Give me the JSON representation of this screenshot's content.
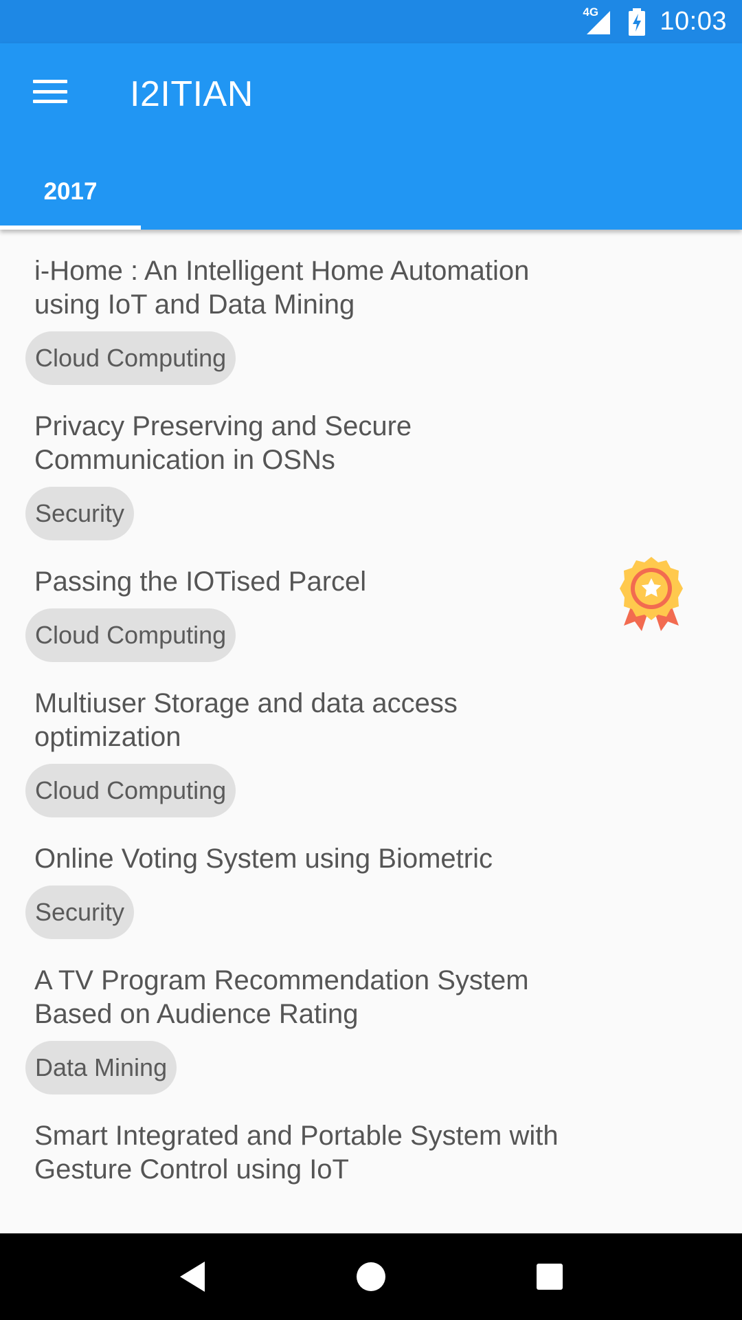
{
  "status_bar": {
    "network_label": "4G",
    "time": "10:03"
  },
  "app_bar": {
    "title": "I2ITIAN",
    "menu_icon": "hamburger-menu-icon"
  },
  "tabs": [
    {
      "label": "2017",
      "selected": true
    }
  ],
  "projects": [
    {
      "title": "i-Home : An Intelligent Home Automation using IoT and Data Mining",
      "category": "Cloud Computing",
      "award": false
    },
    {
      "title": "Privacy Preserving and Secure Communication in OSNs",
      "category": "Security",
      "award": false
    },
    {
      "title": "Passing the IOTised Parcel",
      "category": "Cloud Computing",
      "award": true
    },
    {
      "title": "Multiuser Storage and data access optimization",
      "category": "Cloud Computing",
      "award": false
    },
    {
      "title": "Online Voting System using Biometric",
      "category": "Security",
      "award": false
    },
    {
      "title": "A TV Program Recommendation System Based on Audience Rating",
      "category": "Data Mining",
      "award": false
    },
    {
      "title": "Smart Integrated and Portable System with Gesture Control using IoT",
      "category": "",
      "award": false
    }
  ],
  "colors": {
    "status_bar": "#1E88E5",
    "app_bar": "#2196F3",
    "chip_bg": "#E0E0E0",
    "award_gold": "#FFC94D",
    "award_red": "#F26B50"
  }
}
